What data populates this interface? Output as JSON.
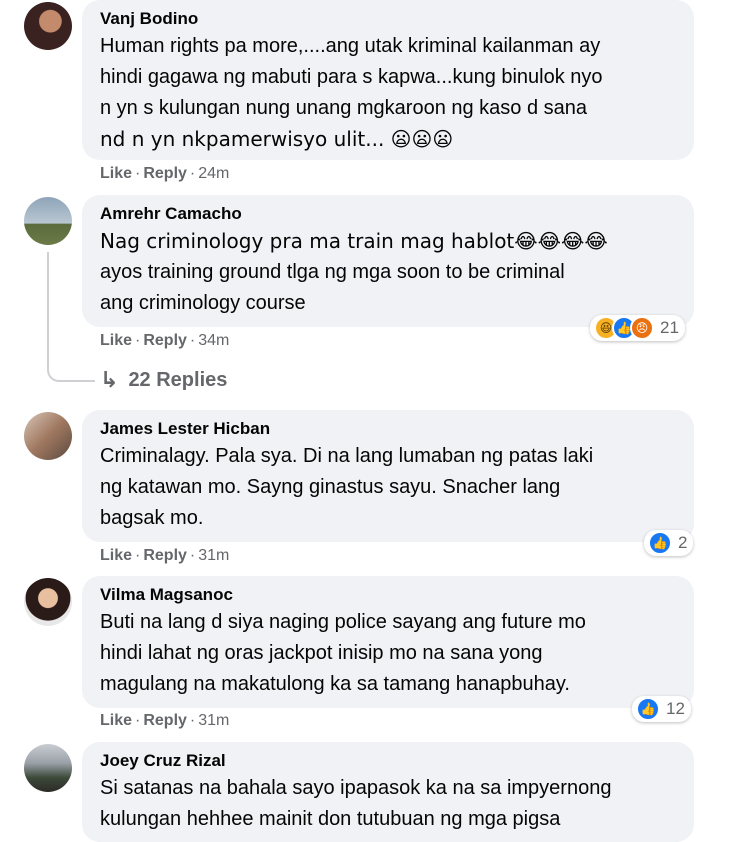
{
  "comments": [
    {
      "author": "Vanj Bodino",
      "lines": [
        "Human rights pa more,....ang utak kriminal kailanman ay",
        "hindi gagawa ng mabuti para s kapwa...kung binulok nyo",
        "n yn s kulungan nung unang mgkaroon ng kaso d sana",
        "nd n yn nkpamerwisyo ulit... 😦😦😦"
      ],
      "like_label": "Like",
      "reply_label": "Reply",
      "time": "24m"
    },
    {
      "author": "Amrehr Camacho",
      "lines": [
        "Nag criminology pra ma train mag hablot😂😂😂😂",
        "ayos training ground tlga ng mga soon to be criminal",
        "ang criminology course"
      ],
      "like_label": "Like",
      "reply_label": "Reply",
      "time": "34m",
      "reactions": {
        "icons": [
          "haha-icon",
          "like-icon",
          "angry-icon"
        ],
        "count": "21"
      },
      "replies_label": "22 Replies"
    },
    {
      "author": "James Lester Hicban",
      "lines": [
        "Criminalagy. Pala sya. Di na lang lumaban ng patas laki",
        "ng katawan mo. Sayng ginastus sayu. Snacher lang",
        "bagsak mo."
      ],
      "like_label": "Like",
      "reply_label": "Reply",
      "time": "31m",
      "reactions": {
        "icons": [
          "like-icon"
        ],
        "count": "2"
      }
    },
    {
      "author": "Vilma Magsanoc",
      "lines": [
        "Buti na lang d siya naging police sayang ang future mo",
        "hindi lahat ng oras jackpot inisip mo na sana yong",
        "magulang na makatulong ka sa tamang hanapbuhay."
      ],
      "like_label": "Like",
      "reply_label": "Reply",
      "time": "31m",
      "reactions": {
        "icons": [
          "like-icon"
        ],
        "count": "12"
      }
    },
    {
      "author": "Joey Cruz Rizal",
      "lines": [
        "Si satanas na bahala sayo ipapasok ka na sa impyernong",
        "kulungan hehhee mainit don tutubuan ng mga pigsa"
      ]
    }
  ],
  "colors": {
    "bubble": "#f0f2f5",
    "secondary_text": "#65676b",
    "like_blue": "#1877f2",
    "haha_yellow": "#f7b125",
    "angry_orange": "#e9710f"
  }
}
